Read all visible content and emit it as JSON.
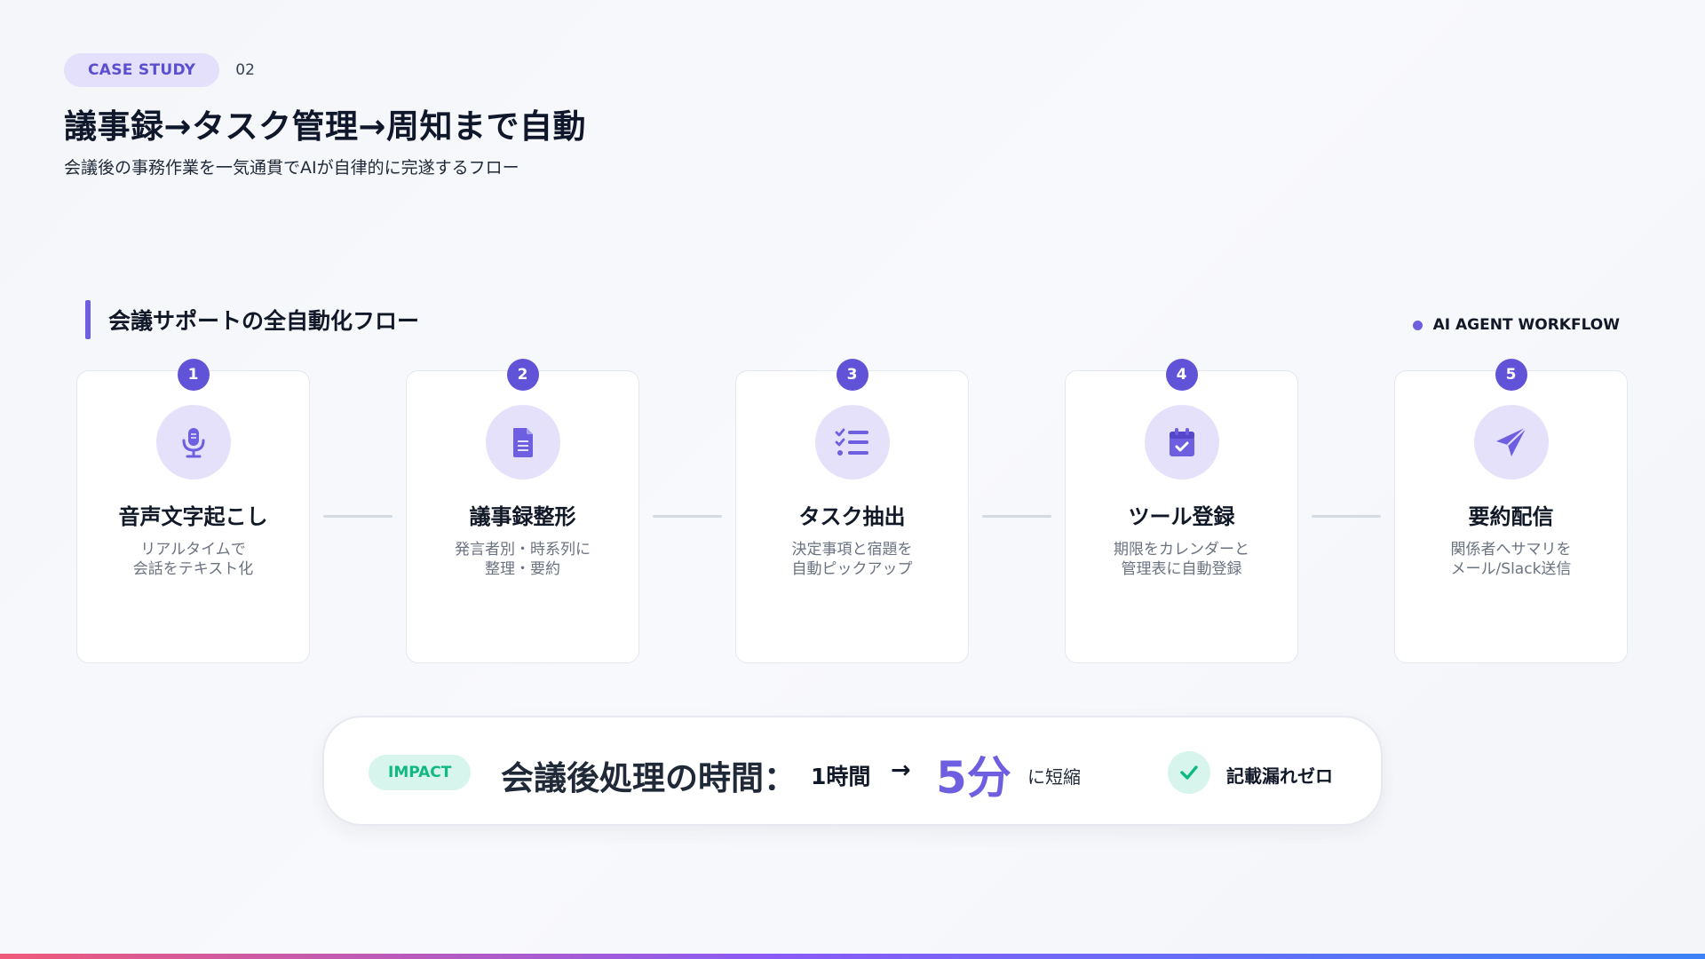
{
  "header": {
    "pill": "CASE STUDY",
    "number": "02",
    "title": "議事録→タスク管理→周知まで自動",
    "subtitle": "会議後の事務作業を一気通貫でAIが自律的に完遂するフロー"
  },
  "section": {
    "title": "会議サポートの全自動化フロー",
    "tag": "AI AGENT WORKFLOW"
  },
  "steps": [
    {
      "num": "1",
      "icon": "microphone-icon",
      "title": "音声文字起こし",
      "desc": [
        "リアルタイムで",
        "会話をテキスト化"
      ]
    },
    {
      "num": "2",
      "icon": "document-icon",
      "title": "議事録整形",
      "desc": [
        "発言者別・時系列に",
        "整理・要約"
      ]
    },
    {
      "num": "3",
      "icon": "checklist-icon",
      "title": "タスク抽出",
      "desc": [
        "決定事項と宿題を",
        "自動ピックアップ"
      ]
    },
    {
      "num": "4",
      "icon": "calendar-check-icon",
      "title": "ツール登録",
      "desc": [
        "期限をカレンダーと",
        "管理表に自動登録"
      ]
    },
    {
      "num": "5",
      "icon": "paper-plane-icon",
      "title": "要約配信",
      "desc": [
        "関係者へサマリを",
        "メール/Slack送信"
      ]
    }
  ],
  "impact": {
    "pill": "IMPACT",
    "label": "会議後処理の時間：",
    "from": "1時間",
    "arrow": "→",
    "to": "5分",
    "suffix": "に短縮",
    "zero": "記載漏れゼロ"
  },
  "colors": {
    "accent": "#6d5fe0",
    "accent_light": "#e5e1fb",
    "impact_green": "#10b981",
    "impact_green_light": "#d7f5ec"
  }
}
